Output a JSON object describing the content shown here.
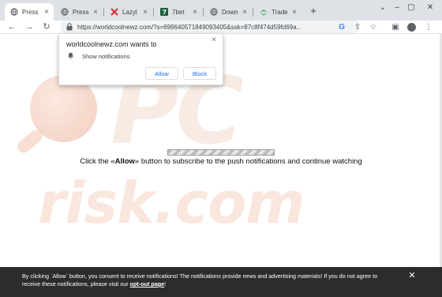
{
  "tabs": [
    {
      "title": "Press",
      "icon": "globe-icon",
      "active": true
    },
    {
      "title": "Press",
      "icon": "globe-icon",
      "active": false
    },
    {
      "title": "Lazyl",
      "icon": "red-x-icon",
      "active": false
    },
    {
      "title": "7bet",
      "icon": "seven-bet-icon",
      "active": false
    },
    {
      "title": "Down",
      "icon": "globe-icon",
      "active": false
    },
    {
      "title": "Trade",
      "icon": "green-bird-icon",
      "active": false
    }
  ],
  "toolbar": {
    "url": "https://worldcoolnewz.com/?s=699640571849093405&ssk=87c8f474d59fd69a..."
  },
  "popup": {
    "title": "worldcoolnewz.com wants to",
    "permission": "Show notifications",
    "allow_label": "Allow",
    "block_label": "Block"
  },
  "page": {
    "headline_before": "Click the «",
    "headline_bold": "Allow",
    "headline_after": "» button to subscribe to the push notifications and continue watching"
  },
  "banner": {
    "text": "By clicking `Allow` button, you consent to receive notifications! The notifications provide news and advertising materials! If you do not agree to receive these notifications, please visit our ",
    "link": "opt-out page",
    "suffix": "!"
  },
  "colors": {
    "tabstrip": "#dee1e6",
    "accent": "#1a73e8",
    "banner_bg": "#2c2c2c"
  }
}
